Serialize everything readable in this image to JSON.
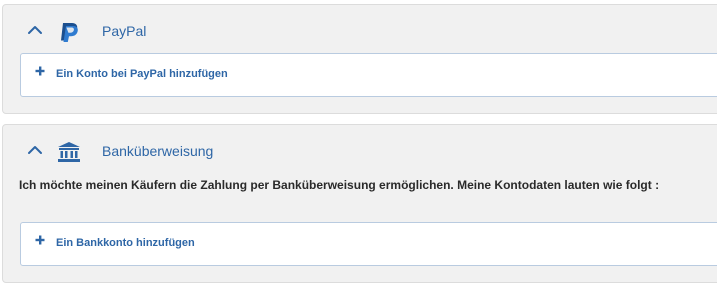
{
  "colors": {
    "accent": "#2e66a6",
    "panel_bg": "#f1f1f1",
    "text": "#2a2a2a"
  },
  "payment_methods": [
    {
      "title": "PayPal",
      "icon": "paypal-logo-icon",
      "toggle_icon": "chevron-up-icon",
      "add_label": "Ein Konto bei PayPal hinzufügen"
    },
    {
      "title": "Banküberweisung",
      "icon": "bank-icon",
      "toggle_icon": "chevron-up-icon",
      "description": "Ich möchte meinen Käufern die Zahlung per Banküberweisung ermöglichen. Meine Kontodaten lauten wie folgt :",
      "add_label": "Ein Bankkonto hinzufügen"
    }
  ]
}
